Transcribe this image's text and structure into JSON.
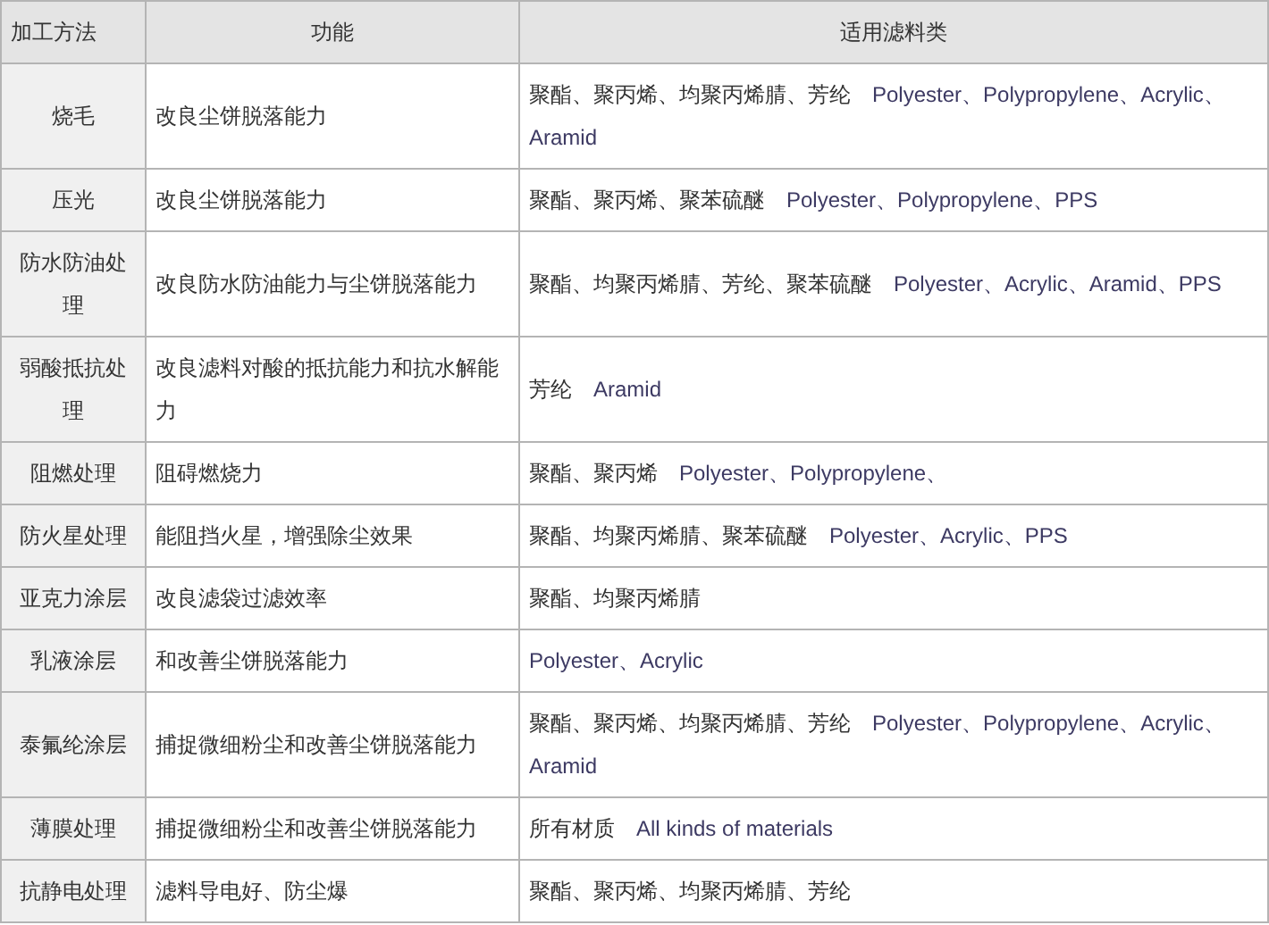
{
  "table": {
    "columns": [
      "加工方法",
      "功能",
      "适用滤料类"
    ],
    "rows": [
      {
        "method": "烧毛",
        "function": "改良尘饼脱落能力",
        "materials_zh": "聚酯、聚丙烯、均聚丙烯腈、芳纶",
        "materials_en": "Polyester、Polypropylene、Acrylic、Aramid"
      },
      {
        "method": "压光",
        "function": "改良尘饼脱落能力",
        "materials_zh": "聚酯、聚丙烯、聚苯硫醚",
        "materials_en": "Polyester、Polypropylene、PPS"
      },
      {
        "method": "防水防油处理",
        "function": "改良防水防油能力与尘饼脱落能力",
        "materials_zh": "聚酯、均聚丙烯腈、芳纶、聚苯硫醚",
        "materials_en": "Polyester、Acrylic、Aramid、PPS"
      },
      {
        "method": "弱酸抵抗处理",
        "function": "改良滤料对酸的抵抗能力和抗水解能力",
        "materials_zh": "芳纶",
        "materials_en": "Aramid"
      },
      {
        "method": "阻燃处理",
        "function": "阻碍燃烧力",
        "materials_zh": "聚酯、聚丙烯",
        "materials_en": "Polyester、Polypropylene、"
      },
      {
        "method": "防火星处理",
        "function": "能阻挡火星，增强除尘效果",
        "materials_zh": "聚酯、均聚丙烯腈、聚苯硫醚",
        "materials_en": "Polyester、Acrylic、PPS"
      },
      {
        "method": "亚克力涂层",
        "function": "改良滤袋过滤效率",
        "materials_zh": "聚酯、均聚丙烯腈"
      },
      {
        "method": "乳液涂层",
        "function": "和改善尘饼脱落能力",
        "materials_en": "Polyester、Acrylic"
      },
      {
        "method": "泰氟纶涂层",
        "function": "捕捉微细粉尘和改善尘饼脱落能力",
        "materials_zh": "聚酯、聚丙烯、均聚丙烯腈、芳纶",
        "materials_en": "Polyester、Polypropylene、Acrylic、Aramid"
      },
      {
        "method": "薄膜处理",
        "function": "捕捉微细粉尘和改善尘饼脱落能力",
        "materials_zh": "所有材质",
        "materials_en": "All kinds of materials"
      },
      {
        "method": "抗静电处理",
        "function": "滤料导电好、防尘爆",
        "materials_zh": "聚酯、聚丙烯、均聚丙烯腈、芳纶"
      }
    ]
  }
}
